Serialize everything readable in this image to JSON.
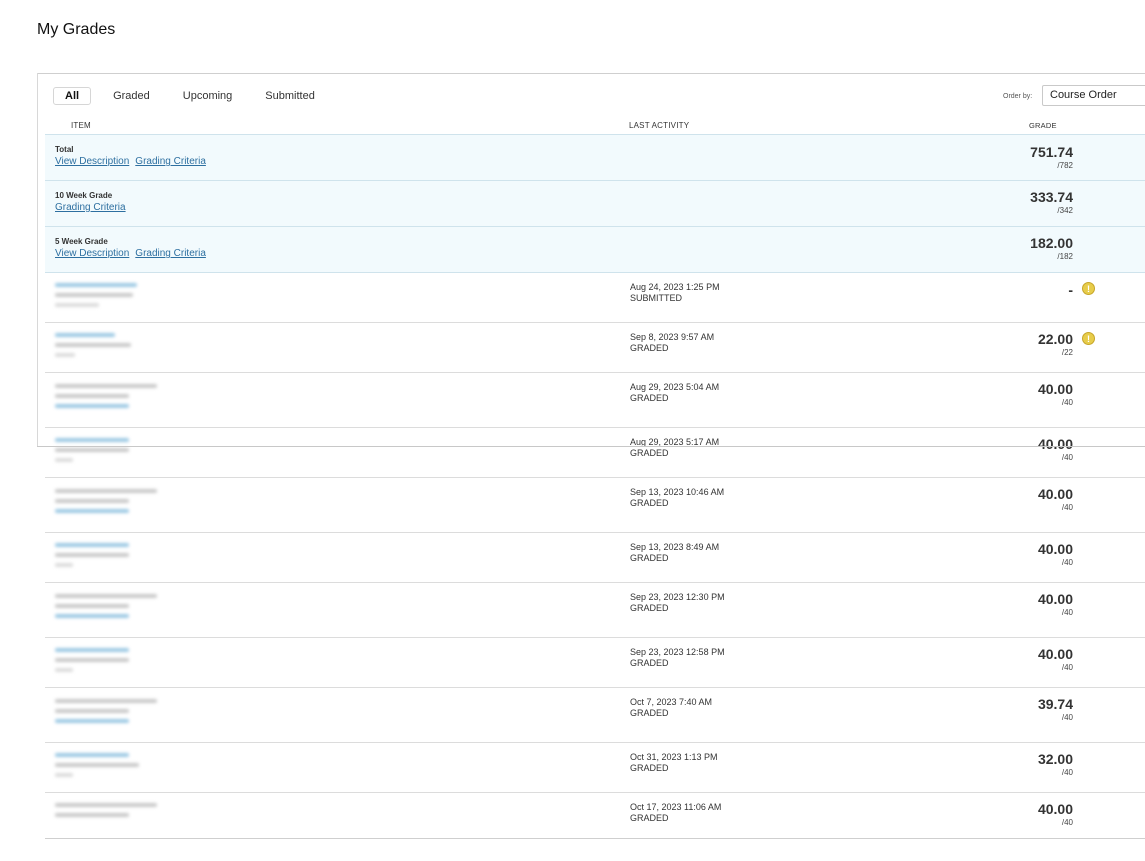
{
  "page": {
    "title": "My Grades"
  },
  "tabs": [
    {
      "label": "All",
      "active": true
    },
    {
      "label": "Graded",
      "active": false
    },
    {
      "label": "Upcoming",
      "active": false
    },
    {
      "label": "Submitted",
      "active": false
    }
  ],
  "order": {
    "label": "Order by:",
    "selected": "Course Order"
  },
  "columns": {
    "item": "ITEM",
    "activity": "LAST ACTIVITY",
    "grade": "GRADE"
  },
  "summary_rows": [
    {
      "title": "Total",
      "links": [
        "View Description",
        "Grading Criteria"
      ],
      "grade": "751.74",
      "out_of": "/782"
    },
    {
      "title": "10 Week Grade",
      "links": [
        "Grading Criteria"
      ],
      "grade": "333.74",
      "out_of": "/342"
    },
    {
      "title": "5 Week Grade",
      "links": [
        "View Description",
        "Grading Criteria"
      ],
      "grade": "182.00",
      "out_of": "/182"
    }
  ],
  "item_rows": [
    {
      "date": "Aug 24, 2023 1:25 PM",
      "status": "SUBMITTED",
      "grade": "-",
      "out_of": "",
      "icon": "exclamation-icon"
    },
    {
      "date": "Sep 8, 2023 9:57 AM",
      "status": "GRADED",
      "grade": "22.00",
      "out_of": "/22",
      "icon": "exclamation-icon"
    },
    {
      "date": "Aug 29, 2023 5:04 AM",
      "status": "GRADED",
      "grade": "40.00",
      "out_of": "/40"
    },
    {
      "date": "Aug 29, 2023 5:17 AM",
      "status": "GRADED",
      "grade": "40.00",
      "out_of": "/40"
    },
    {
      "date": "Sep 13, 2023 10:46 AM",
      "status": "GRADED",
      "grade": "40.00",
      "out_of": "/40"
    },
    {
      "date": "Sep 13, 2023 8:49 AM",
      "status": "GRADED",
      "grade": "40.00",
      "out_of": "/40"
    },
    {
      "date": "Sep 23, 2023 12:30 PM",
      "status": "GRADED",
      "grade": "40.00",
      "out_of": "/40"
    },
    {
      "date": "Sep 23, 2023 12:58 PM",
      "status": "GRADED",
      "grade": "40.00",
      "out_of": "/40"
    },
    {
      "date": "Oct 7, 2023 7:40 AM",
      "status": "GRADED",
      "grade": "39.74",
      "out_of": "/40"
    },
    {
      "date": "Oct 31, 2023 1:13 PM",
      "status": "GRADED",
      "grade": "32.00",
      "out_of": "/40"
    },
    {
      "date": "Oct 17, 2023 11:06 AM",
      "status": "GRADED",
      "grade": "40.00",
      "out_of": "/40"
    }
  ],
  "colors": {
    "link": "#2d6fa0",
    "summary_bg": "#f2fafd",
    "warning_icon": "#e7cc4a"
  }
}
